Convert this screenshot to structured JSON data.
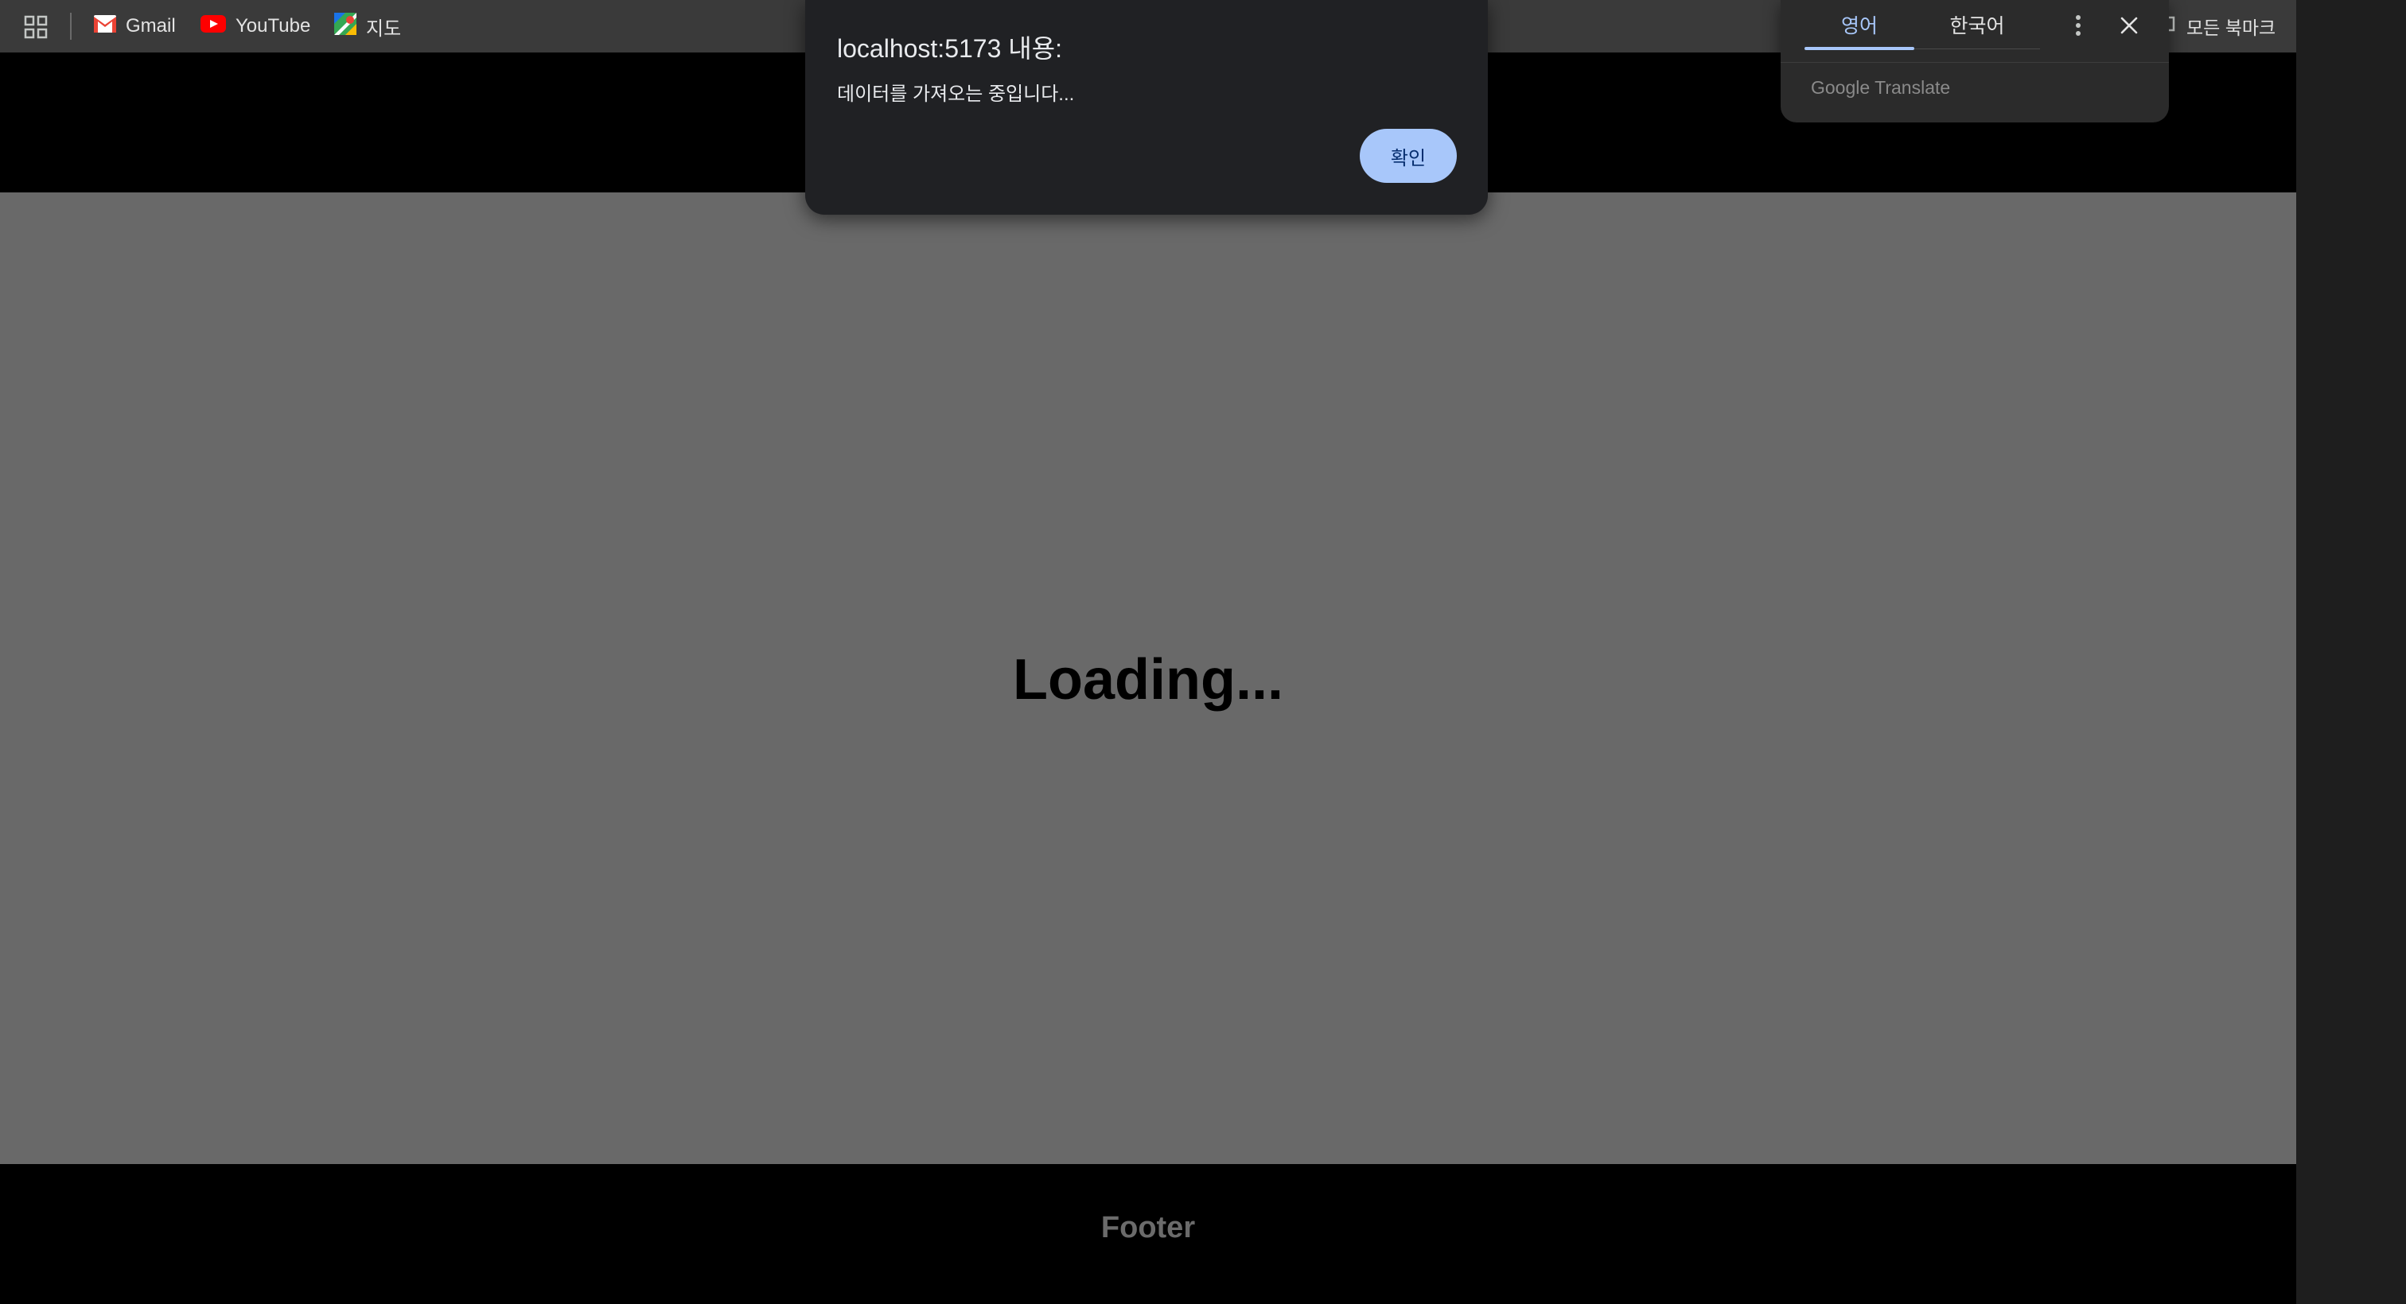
{
  "bookmarks": {
    "items": [
      {
        "label": "Gmail"
      },
      {
        "label": "YouTube"
      },
      {
        "label": "지도"
      }
    ],
    "all_bookmarks_label": "모든 북마크"
  },
  "page": {
    "loading_text": "Loading...",
    "footer_text": "Footer"
  },
  "alert": {
    "title": "localhost:5173 내용:",
    "message": "데이터를 가져오는 중입니다...",
    "ok_label": "확인"
  },
  "translate": {
    "tabs": [
      {
        "label": "영어",
        "active": true
      },
      {
        "label": "한국어",
        "active": false
      }
    ],
    "brand": "Google Translate"
  },
  "colors": {
    "accent": "#a8c7fa",
    "page_main": "#696969",
    "header_footer": "#000000",
    "dialog_bg": "#202124"
  }
}
